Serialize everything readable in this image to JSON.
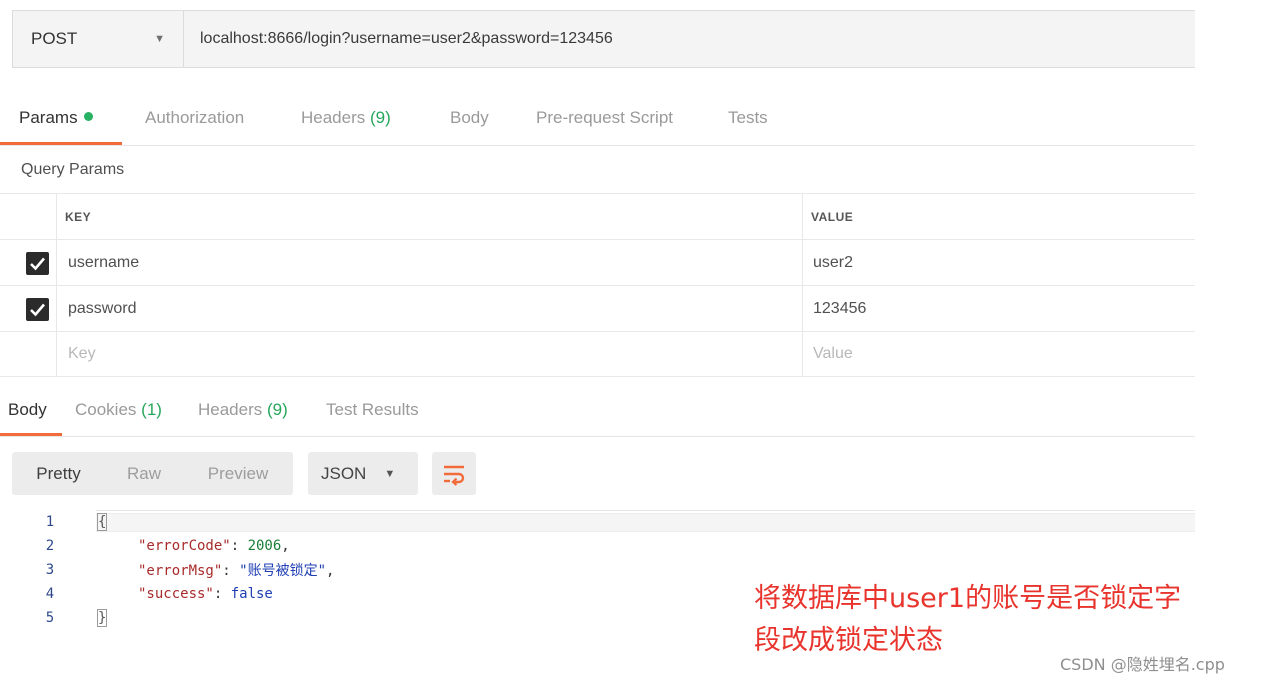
{
  "request": {
    "method": "POST",
    "url": "localhost:8666/login?username=user2&password=123456"
  },
  "request_tabs": [
    {
      "label": "Params",
      "active": true
    },
    {
      "label": "Authorization"
    },
    {
      "label": "Headers",
      "count": "(9)"
    },
    {
      "label": "Body"
    },
    {
      "label": "Pre-request Script"
    },
    {
      "label": "Tests"
    }
  ],
  "query_params": {
    "title": "Query Params",
    "columns": [
      "KEY",
      "VALUE"
    ],
    "rows": [
      {
        "key": "username",
        "value": "user2",
        "checked": true
      },
      {
        "key": "password",
        "value": "123456",
        "checked": true
      }
    ],
    "placeholder": {
      "key": "Key",
      "value": "Value"
    }
  },
  "response_tabs": [
    {
      "label": "Body",
      "active": true
    },
    {
      "label": "Cookies",
      "count": "(1)"
    },
    {
      "label": "Headers",
      "count": "(9)"
    },
    {
      "label": "Test Results"
    }
  ],
  "view_modes": [
    "Pretty",
    "Raw",
    "Preview"
  ],
  "language": "JSON",
  "code": {
    "line_numbers": [
      "1",
      "2",
      "3",
      "4",
      "5"
    ],
    "open_brace": "{",
    "close_brace": "}",
    "fields": [
      {
        "key": "\"errorCode\"",
        "value": "2006",
        "trail": ","
      },
      {
        "key": "\"errorMsg\"",
        "value": "\"账号被锁定\"",
        "trail": ","
      },
      {
        "key": "\"success\"",
        "value": "false",
        "trail": ""
      }
    ]
  },
  "annotation": "将数据库中user1的账号是否锁定字段改成锁定状态",
  "watermark": "CSDN @隐姓埋名.cpp",
  "colors": {
    "accent": "#f26b3a",
    "green": "#26b163",
    "annotation": "#e8342c"
  }
}
